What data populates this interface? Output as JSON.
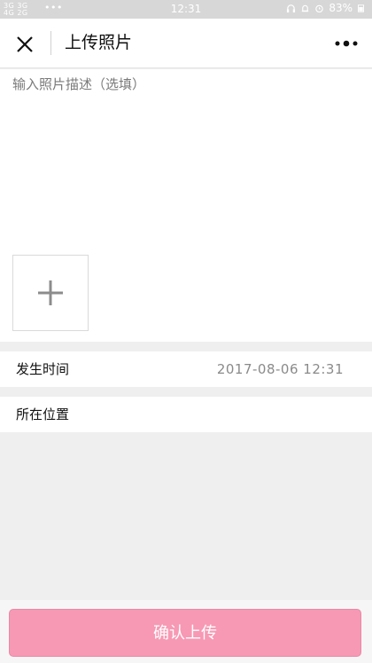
{
  "status_bar": {
    "network_line1": "3G 3G",
    "network_line2": "4G 2G",
    "time": "12:31",
    "battery": "83%"
  },
  "header": {
    "title": "上传照片",
    "close_icon": "close-icon",
    "more_icon": "more-dots-icon"
  },
  "description": {
    "placeholder": "输入照片描述（选填）",
    "value": ""
  },
  "add_photo": {
    "icon": "plus-icon"
  },
  "occurrence_time": {
    "label": "发生时间",
    "value": "2017-08-06 12:31"
  },
  "location": {
    "label": "所在位置",
    "value": ""
  },
  "footer": {
    "confirm_label": "确认上传"
  },
  "colors": {
    "accent": "#f799b4",
    "background": "#efefef",
    "status_bar": "#d7d7d7"
  }
}
